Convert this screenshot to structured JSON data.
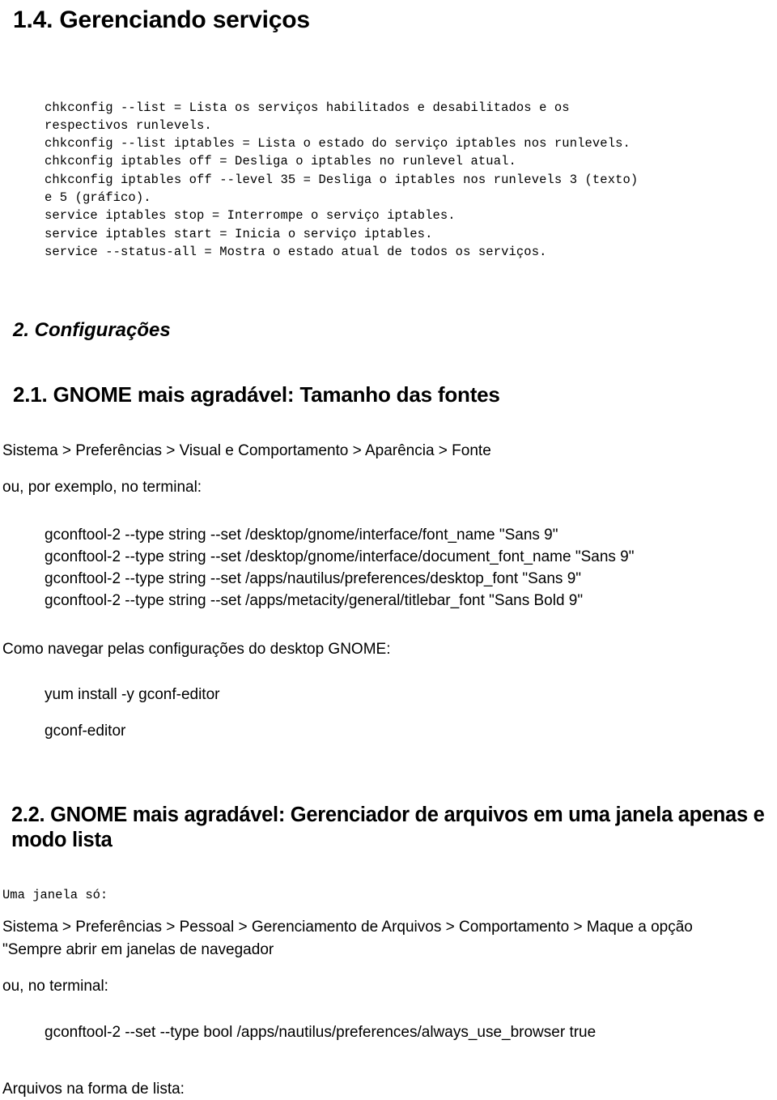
{
  "document": {
    "language": "pt-BR",
    "background_color": "#ffffff",
    "text_color": "#000000"
  },
  "section_1_4": {
    "heading": "1.4. Gerenciando serviços",
    "code_block": "chkconfig --list = Lista os serviços habilitados e desabilitados e os\nrespectivos runlevels.\nchkconfig --list iptables = Lista o estado do serviço iptables nos runlevels.\nchkconfig iptables off = Desliga o iptables no runlevel atual.\nchkconfig iptables off --level 35 = Desliga o iptables nos runlevels 3 (texto)\ne 5 (gráfico).\nservice iptables stop = Interrompe o serviço iptables.\nservice iptables start = Inicia o serviço iptables.\nservice --status-all = Mostra o estado atual de todos os serviços."
  },
  "section_2": {
    "heading": "2. Configurações"
  },
  "section_2_1": {
    "heading": "2.1. GNOME mais agradável: Tamanho das fontes",
    "path_line": "Sistema > Preferências > Visual e Comportamento > Aparência > Fonte",
    "intro_line": "ou, por exemplo, no terminal:",
    "commands": "gconftool-2 --type string --set /desktop/gnome/interface/font_name \"Sans 9\"\ngconftool-2 --type string --set /desktop/gnome/interface/document_font_name \"Sans 9\"\ngconftool-2 --type string --set /apps/nautilus/preferences/desktop_font \"Sans 9\"\ngconftool-2 --type string --set /apps/metacity/general/titlebar_font \"Sans Bold 9\"",
    "navigate_line": "Como navegar pelas configurações do desktop GNOME:",
    "install_command": "yum install -y gconf-editor",
    "run_command": "gconf-editor"
  },
  "section_2_2": {
    "heading": "2.2. GNOME mais agradável: Gerenciador de arquivos em uma janela apenas e modo lista",
    "mono_note": "Uma janela só:",
    "path_line_1": "Sistema > Preferências > Pessoal > Gerenciamento de Arquivos > Comportamento > Maque a opção",
    "path_line_2": "\"Sempre abrir em janelas de navegador",
    "intro_line": "ou, no terminal:",
    "command": "gconftool-2 --set --type bool /apps/nautilus/preferences/always_use_browser true",
    "footer_line": "Arquivos na forma de lista:"
  }
}
